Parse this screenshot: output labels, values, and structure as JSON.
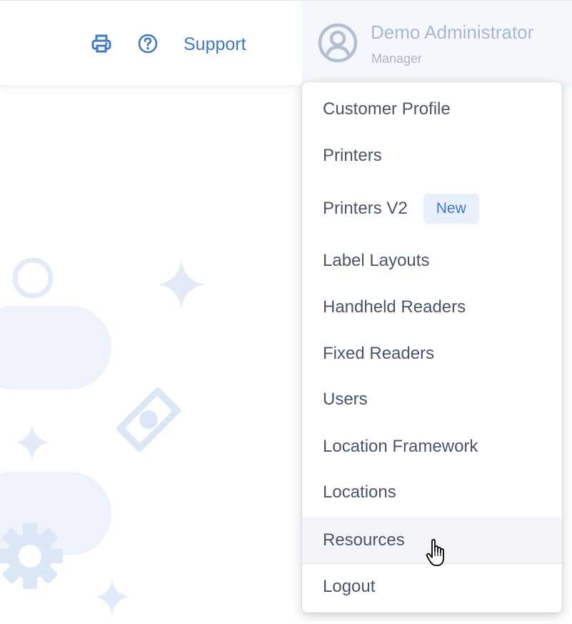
{
  "header": {
    "print_icon": "printer-icon",
    "help_icon": "question-circle-icon",
    "support_label": "Support",
    "user": {
      "name": "Demo Administrator",
      "role": "Manager",
      "avatar_icon": "user-circle-icon"
    }
  },
  "menu": {
    "items": [
      {
        "label": "Customer Profile"
      },
      {
        "label": "Printers"
      },
      {
        "label": "Printers V2",
        "badge": "New"
      },
      {
        "label": "Label Layouts"
      },
      {
        "label": "Handheld Readers"
      },
      {
        "label": "Fixed Readers"
      },
      {
        "label": "Users"
      },
      {
        "label": "Location Framework"
      },
      {
        "label": "Locations"
      },
      {
        "label": "Resources"
      },
      {
        "label": "Logout"
      }
    ],
    "hovered_item": "Resources"
  },
  "colors": {
    "accent": "#3f78c4",
    "menu_text": "#4a5563",
    "user_text": "#a9b8cd",
    "badge_bg": "#e8f0fc",
    "decor": "#e9f0fb"
  }
}
